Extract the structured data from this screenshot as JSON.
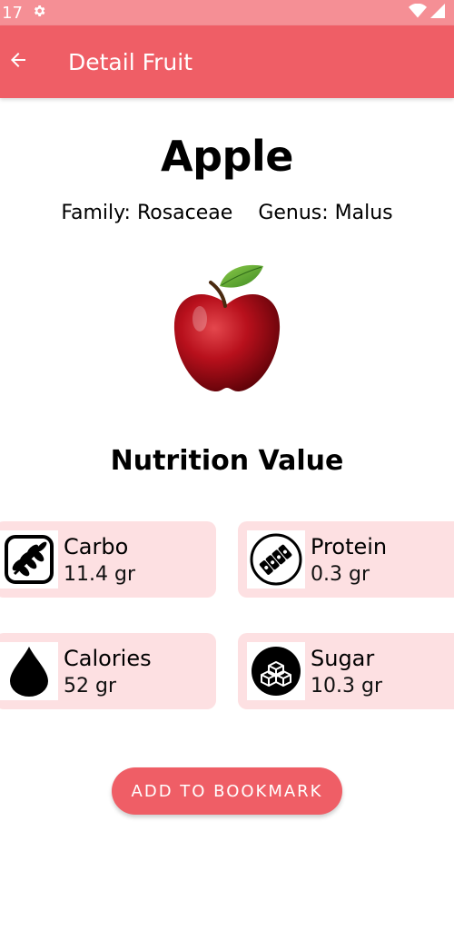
{
  "status_bar": {
    "time": ":17"
  },
  "app_bar": {
    "title": "Detail Fruit"
  },
  "fruit": {
    "name": "Apple",
    "family": "Family: Rosaceae",
    "genus": "Genus: Malus"
  },
  "nutrition": {
    "title": "Nutrition Value",
    "items": [
      {
        "label": "Carbo",
        "value": "11.4 gr",
        "icon": "wheat-icon"
      },
      {
        "label": "Protein",
        "value": "0.3 gr",
        "icon": "protein-icon"
      },
      {
        "label": "Calories",
        "value": "52 gr",
        "icon": "drop-icon"
      },
      {
        "label": "Sugar",
        "value": "10.3 gr",
        "icon": "sugar-cubes-icon"
      }
    ]
  },
  "actions": {
    "bookmark_label": "ADD TO BOOKMARK"
  },
  "colors": {
    "primary": "#ef5e66",
    "status_bar": "#f58f95",
    "card_bg": "#fde0e2"
  }
}
